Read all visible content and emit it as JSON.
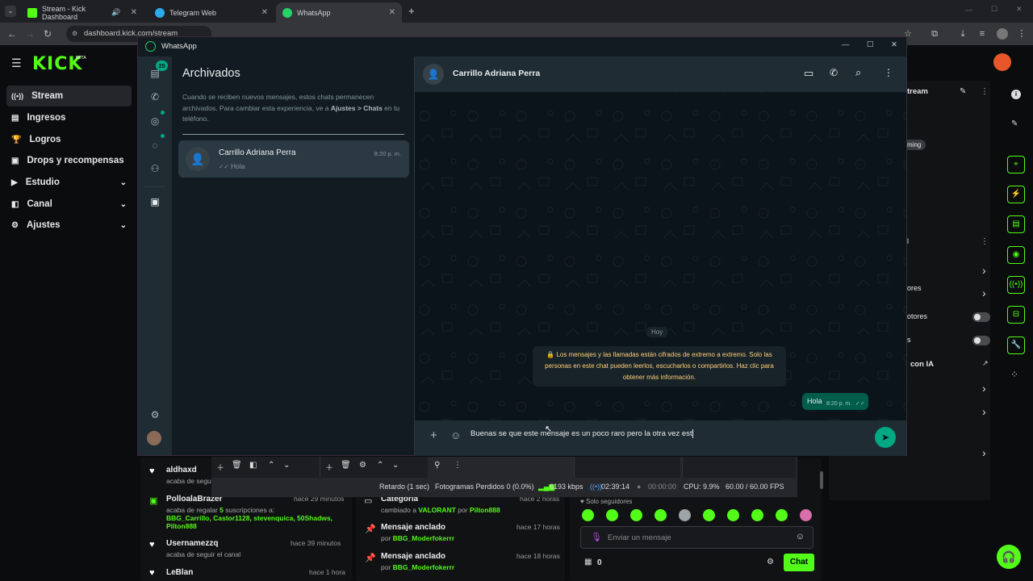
{
  "browser": {
    "tabs": [
      {
        "label": "Stream - Kick Dashboard",
        "favicon_color": "#53fc18",
        "active": false
      },
      {
        "label": "Telegram Web",
        "favicon_color": "#2aabee",
        "active": false
      },
      {
        "label": "WhatsApp",
        "favicon_color": "#25d366",
        "active": true
      }
    ],
    "new_tab": "+",
    "url": "dashboard.kick.com/stream"
  },
  "kick": {
    "logo": "KICK",
    "beta": "BETA",
    "nav": [
      {
        "label": "Stream",
        "icon": "broadcast-icon",
        "active": true,
        "expandable": false
      },
      {
        "label": "Ingresos",
        "icon": "money-icon",
        "active": false,
        "expandable": false
      },
      {
        "label": "Logros",
        "icon": "trophy-icon",
        "active": false,
        "expandable": false
      },
      {
        "label": "Drops y recompensas",
        "icon": "gift-icon",
        "active": false,
        "expandable": false
      },
      {
        "label": "Estudio",
        "icon": "camera-icon",
        "active": false,
        "expandable": true
      },
      {
        "label": "Canal",
        "icon": "channel-icon",
        "active": false,
        "expandable": true
      },
      {
        "label": "Ajustes",
        "icon": "gear-icon",
        "active": false,
        "expandable": true
      }
    ],
    "right_panel": {
      "title_partial": "tream",
      "badge_partial": "ming",
      "row1": "ores",
      "row2": "otores",
      "row3": "s",
      "row4": "con IA",
      "panel2_title": "l"
    },
    "activity": [
      {
        "name": "aldhaxd",
        "time": "",
        "text": "acaba de segui",
        "icon": "heart-icon"
      },
      {
        "name": "PolloalaBrazer",
        "time": "hace 29 minutos",
        "text_pre": "acaba de regalar ",
        "count": "5",
        "text_post": " suscripciones a:",
        "recipients": "BBG_Carrillo, Castor1128, stevenquica, 50Shadws, Pilton888",
        "icon": "gift-icon"
      },
      {
        "name": "Usernamezzq",
        "time": "hace 39 minutos",
        "text": "acaba de seguir el canal",
        "icon": "heart-icon"
      },
      {
        "name": "LeBlan",
        "time": "hace 1 hora",
        "text": "",
        "icon": "heart-icon"
      }
    ],
    "events": [
      {
        "title": "Categoría",
        "time": "hace 2 horas",
        "text_pre": "cambiado a ",
        "highlight": "VALORANT",
        "text_mid": " por ",
        "user": "Pilton888"
      },
      {
        "title": "Mensaje anclado",
        "time": "hace 17 horas",
        "text_pre": "por ",
        "user": "BBG_Moderfokerrr"
      },
      {
        "title": "Mensaje anclado",
        "time": "hace 18 horas",
        "text_pre": "por ",
        "user": "BBG_Moderfokerrr"
      }
    ],
    "chat": {
      "followers_only": "Solo seguidores",
      "placeholder": "Enviar un mensaje",
      "count": "0",
      "button": "Chat"
    },
    "obs": {
      "delay": "Retardo (1 sec)",
      "dropped": "Fotogramas Perdidos 0 (0.0%)",
      "bitrate": "6193 kbps",
      "live_time": "02:39:14",
      "rec_time": "00:00:00",
      "cpu": "CPU: 9.9%",
      "fps": "60.00 / 60.00 FPS"
    }
  },
  "whatsapp": {
    "window_title": "WhatsApp",
    "window_controls": {
      "minimize": "—",
      "maximize": "☐",
      "close": "✕"
    },
    "nav_badge": "25",
    "archived": {
      "title": "Archivados",
      "info_pre": "Cuando se reciben nuevos mensajes, estos chats permanecen archivados. Para cambiar esta experiencia, ve a ",
      "info_bold": "Ajustes > Chats",
      "info_post": " en tu teléfono."
    },
    "chats": [
      {
        "name": "Carrillo Adriana Perra",
        "time": "8:20 p. m.",
        "last_message": "Hola",
        "ticks": "✓✓"
      }
    ],
    "conversation": {
      "contact_name": "Carrillo Adriana Perra",
      "date_separator": "Hoy",
      "encryption_notice": "🔒 Los mensajes y las llamadas están cifrados de extremo a extremo. Solo las personas en este chat pueden leerlos, escucharlos o compartirlos. Haz clic para obtener más información.",
      "messages": [
        {
          "text": "Hola",
          "time": "8:20 p. m.",
          "ticks": "✓✓",
          "outgoing": true
        }
      ],
      "composer_value": "Buenas se que este mensaje es un poco raro pero la otra vez est"
    },
    "colors": {
      "outgoing_bubble": "#005c4b",
      "accent": "#00a884",
      "kick_green": "#53fc18"
    }
  }
}
